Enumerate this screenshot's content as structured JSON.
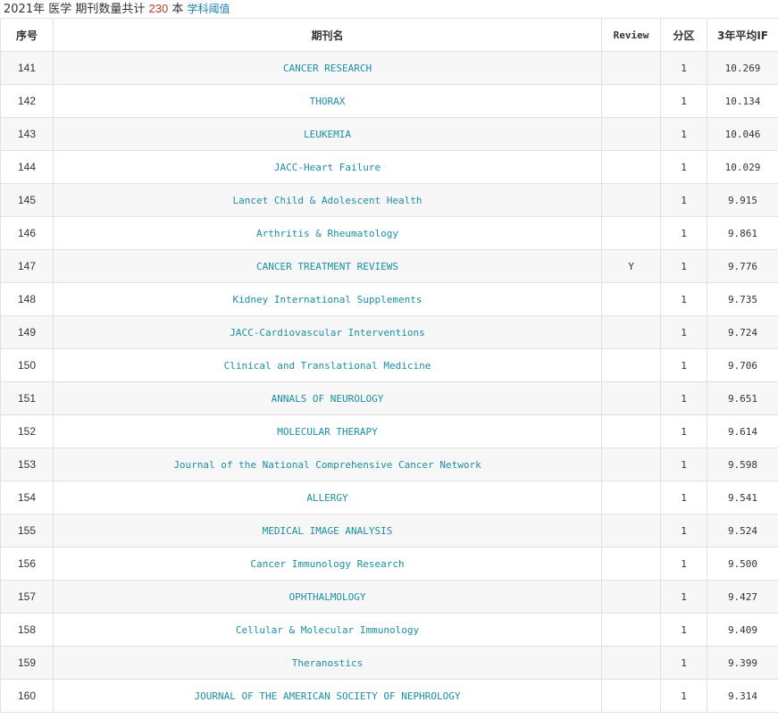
{
  "header": {
    "year": "2021年",
    "subject": "医学",
    "count_prefix": "期刊数量共计",
    "count": "230",
    "count_suffix": "本",
    "threshold_link": "学科阈值"
  },
  "table": {
    "columns": {
      "index": "序号",
      "journal": "期刊名",
      "review": "Review",
      "zone": "分区",
      "if3": "3年平均IF"
    },
    "rows": [
      {
        "index": "141",
        "journal": "CANCER RESEARCH",
        "review": "",
        "zone": "1",
        "if3": "10.269"
      },
      {
        "index": "142",
        "journal": "THORAX",
        "review": "",
        "zone": "1",
        "if3": "10.134"
      },
      {
        "index": "143",
        "journal": "LEUKEMIA",
        "review": "",
        "zone": "1",
        "if3": "10.046"
      },
      {
        "index": "144",
        "journal": "JACC-Heart Failure",
        "review": "",
        "zone": "1",
        "if3": "10.029"
      },
      {
        "index": "145",
        "journal": "Lancet Child & Adolescent Health",
        "review": "",
        "zone": "1",
        "if3": "9.915"
      },
      {
        "index": "146",
        "journal": "Arthritis & Rheumatology",
        "review": "",
        "zone": "1",
        "if3": "9.861"
      },
      {
        "index": "147",
        "journal": "CANCER TREATMENT REVIEWS",
        "review": "Y",
        "zone": "1",
        "if3": "9.776"
      },
      {
        "index": "148",
        "journal": "Kidney International Supplements",
        "review": "",
        "zone": "1",
        "if3": "9.735"
      },
      {
        "index": "149",
        "journal": "JACC-Cardiovascular Interventions",
        "review": "",
        "zone": "1",
        "if3": "9.724"
      },
      {
        "index": "150",
        "journal": "Clinical and Translational Medicine",
        "review": "",
        "zone": "1",
        "if3": "9.706"
      },
      {
        "index": "151",
        "journal": "ANNALS OF NEUROLOGY",
        "review": "",
        "zone": "1",
        "if3": "9.651"
      },
      {
        "index": "152",
        "journal": "MOLECULAR THERAPY",
        "review": "",
        "zone": "1",
        "if3": "9.614"
      },
      {
        "index": "153",
        "journal": "Journal of the National Comprehensive Cancer Network",
        "review": "",
        "zone": "1",
        "if3": "9.598"
      },
      {
        "index": "154",
        "journal": "ALLERGY",
        "review": "",
        "zone": "1",
        "if3": "9.541"
      },
      {
        "index": "155",
        "journal": "MEDICAL IMAGE ANALYSIS",
        "review": "",
        "zone": "1",
        "if3": "9.524"
      },
      {
        "index": "156",
        "journal": "Cancer Immunology Research",
        "review": "",
        "zone": "1",
        "if3": "9.500"
      },
      {
        "index": "157",
        "journal": "OPHTHALMOLOGY",
        "review": "",
        "zone": "1",
        "if3": "9.427"
      },
      {
        "index": "158",
        "journal": "Cellular & Molecular Immunology",
        "review": "",
        "zone": "1",
        "if3": "9.409"
      },
      {
        "index": "159",
        "journal": "Theranostics",
        "review": "",
        "zone": "1",
        "if3": "9.399"
      },
      {
        "index": "160",
        "journal": "JOURNAL OF THE AMERICAN SOCIETY OF NEPHROLOGY",
        "review": "",
        "zone": "1",
        "if3": "9.314"
      }
    ]
  }
}
